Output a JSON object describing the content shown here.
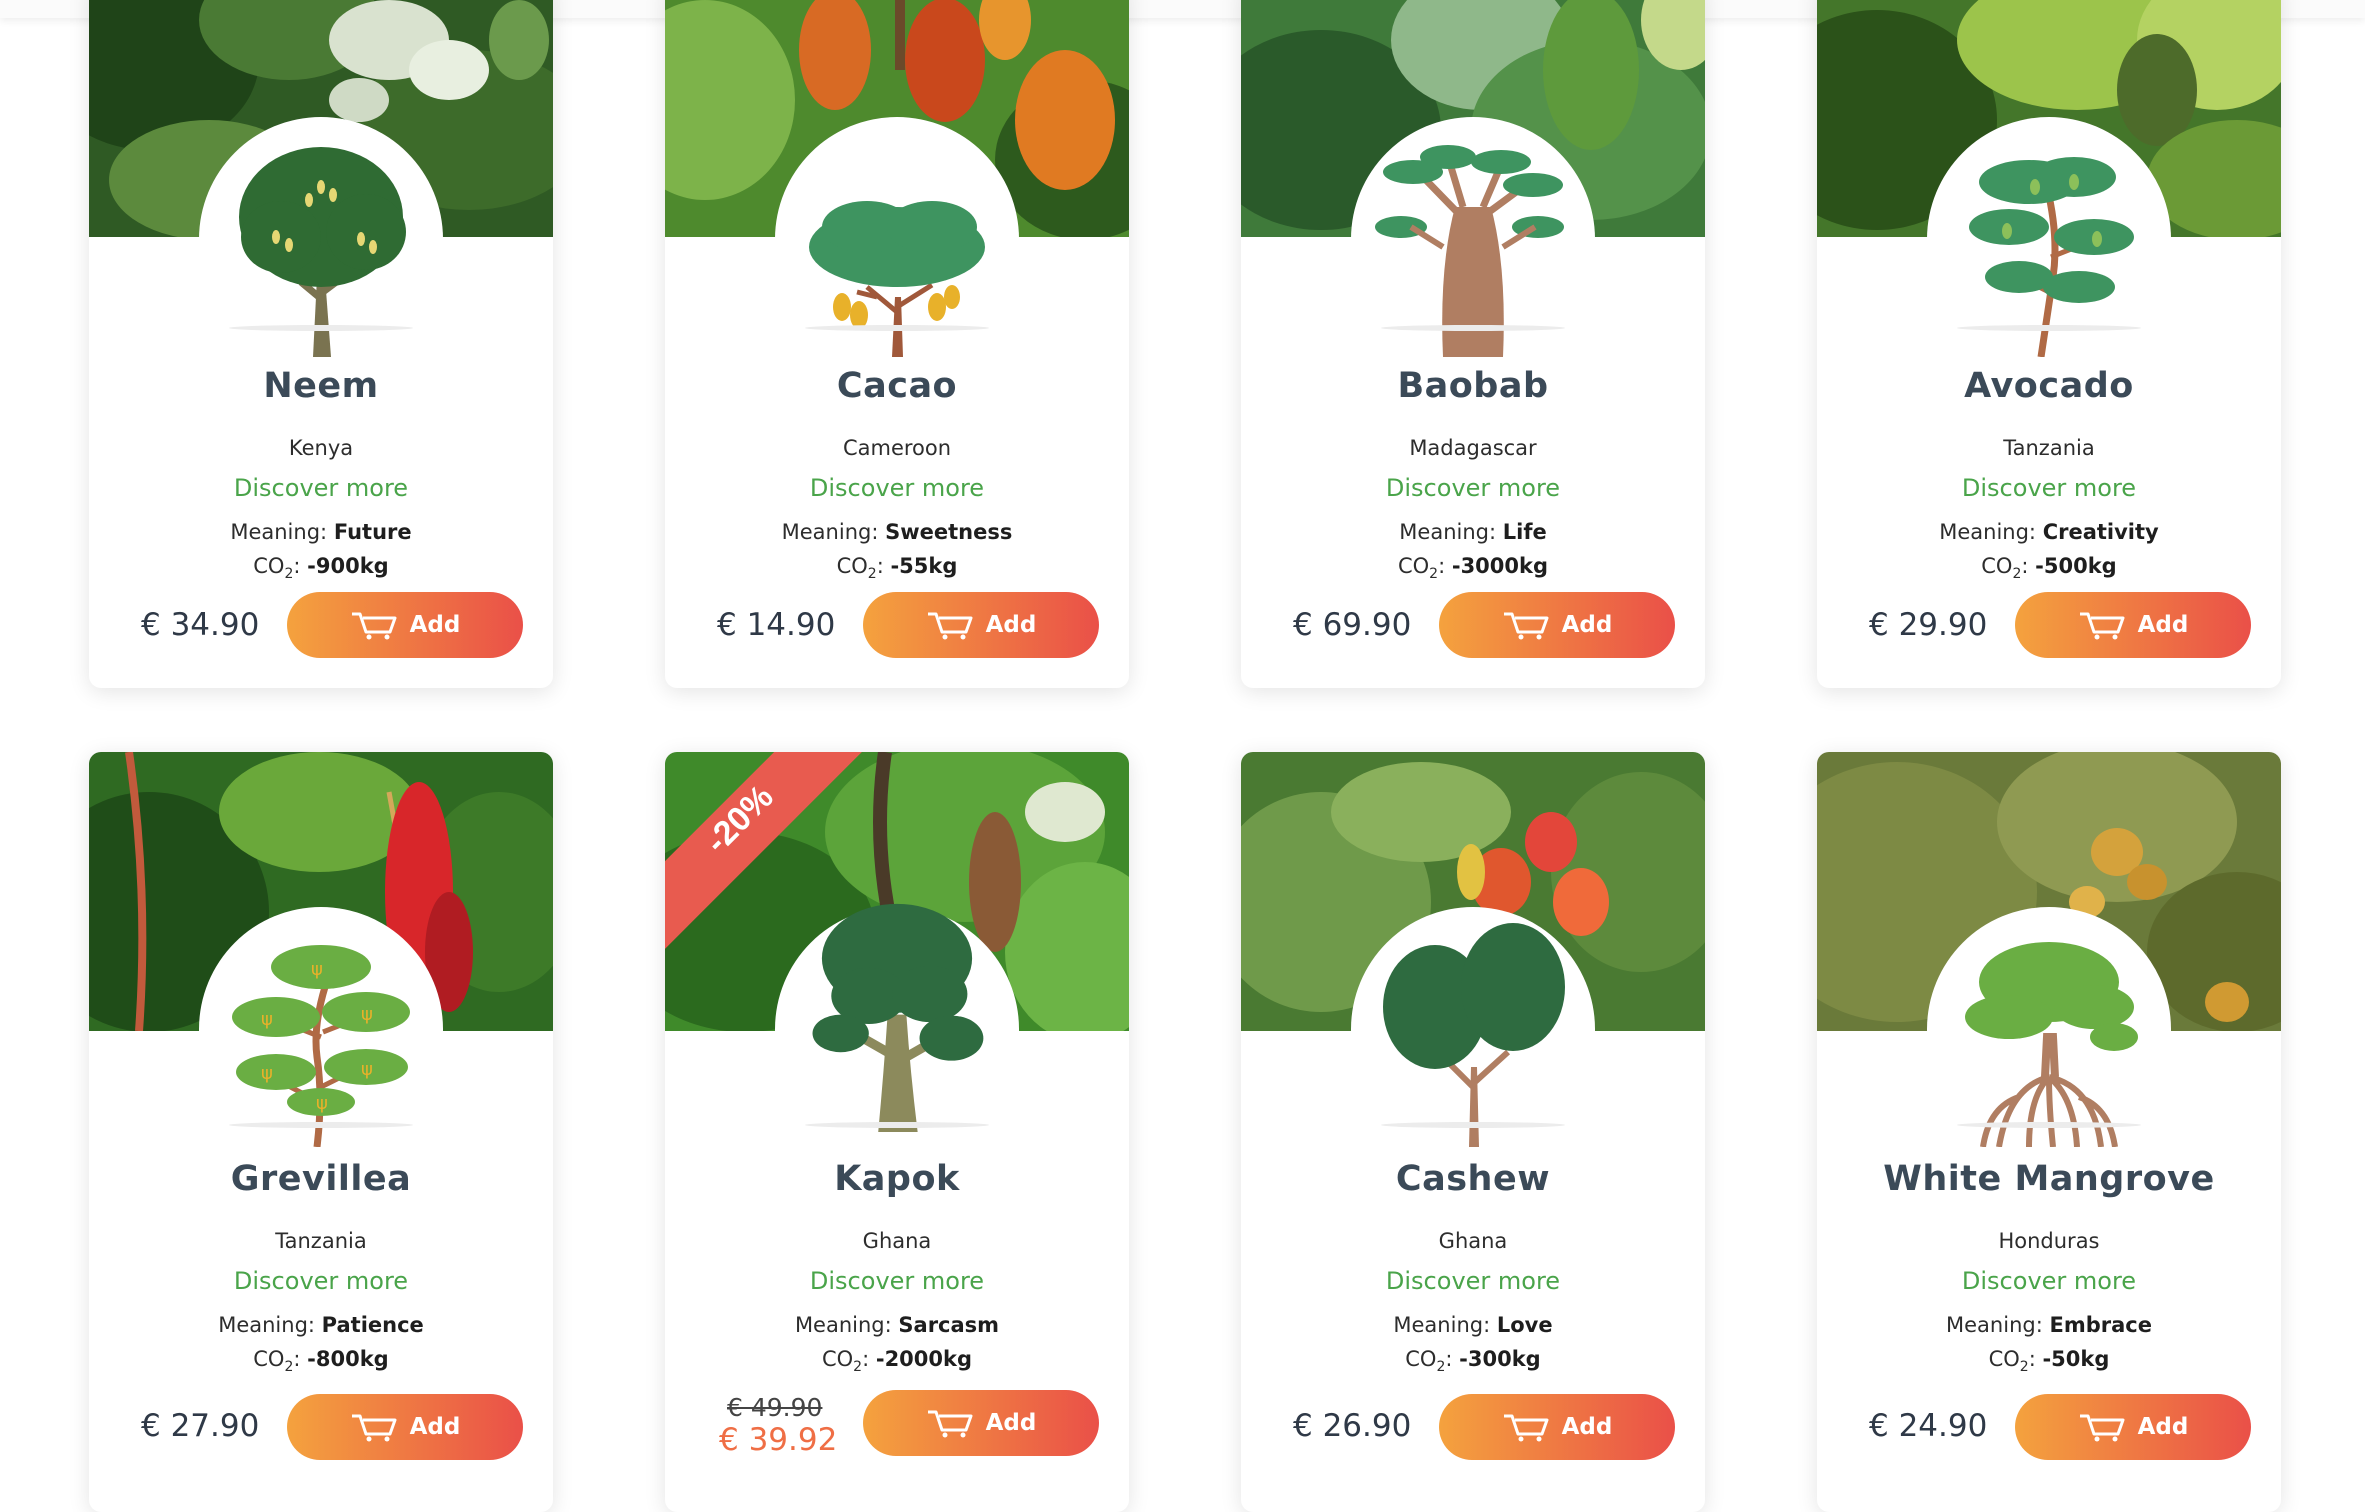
{
  "currency": "€",
  "labels": {
    "discover": "Discover more",
    "meaning_prefix": "Meaning:",
    "co2_prefix": "CO",
    "co2_sub": "2",
    "add": "Add"
  },
  "products": [
    {
      "name": "Neem",
      "country": "Kenya",
      "meaning": "Future",
      "co2": "-900kg",
      "price": "€ 34.90",
      "tree_icon": "round-tree-icon"
    },
    {
      "name": "Cacao",
      "country": "Cameroon",
      "meaning": "Sweetness",
      "co2": "-55kg",
      "price": "€ 14.90",
      "tree_icon": "cacao-tree-icon"
    },
    {
      "name": "Baobab",
      "country": "Madagascar",
      "meaning": "Life",
      "co2": "-3000kg",
      "price": "€ 69.90",
      "tree_icon": "baobab-tree-icon"
    },
    {
      "name": "Avocado",
      "country": "Tanzania",
      "meaning": "Creativity",
      "co2": "-500kg",
      "price": "€ 29.90",
      "tree_icon": "avocado-tree-icon"
    },
    {
      "name": "Grevillea",
      "country": "Tanzania",
      "meaning": "Patience",
      "co2": "-800kg",
      "price": "€ 27.90",
      "tree_icon": "grevillea-tree-icon"
    },
    {
      "name": "Kapok",
      "country": "Ghana",
      "meaning": "Sarcasm",
      "co2": "-2000kg",
      "old_price": "€ 49.90",
      "price": "€ 39.92",
      "discount": "-20%",
      "tree_icon": "kapok-tree-icon"
    },
    {
      "name": "Cashew",
      "country": "Ghana",
      "meaning": "Love",
      "co2": "-300kg",
      "price": "€ 26.90",
      "tree_icon": "cashew-tree-icon"
    },
    {
      "name": "White Mangrove",
      "country": "Honduras",
      "meaning": "Embrace",
      "co2": "-50kg",
      "price": "€ 24.90",
      "tree_icon": "mangrove-tree-icon"
    }
  ],
  "colors": {
    "title": "#3b4a58",
    "discover": "#4aa44a",
    "button_start": "#f4a23e",
    "button_end": "#ea5048",
    "sale_price": "#ef6e45",
    "ribbon": "#e85b4f"
  }
}
